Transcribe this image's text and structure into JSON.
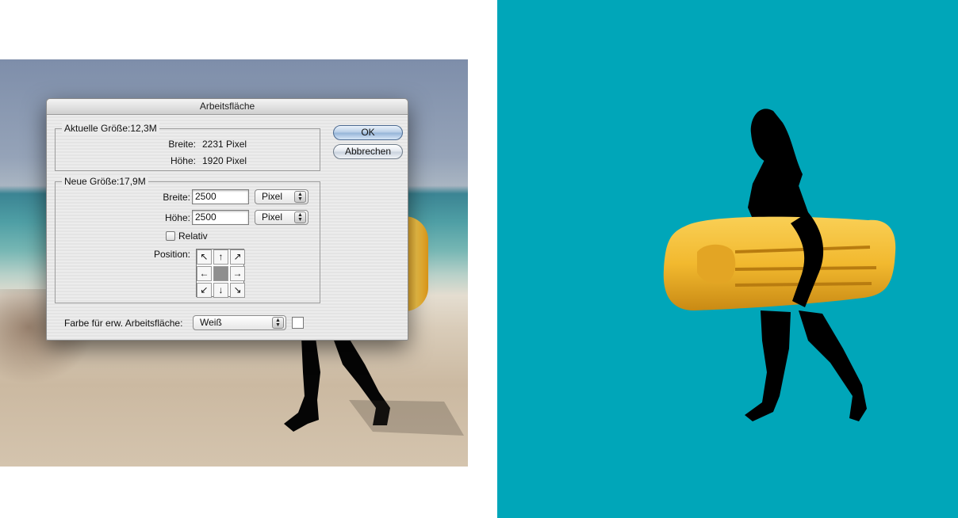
{
  "dialog": {
    "title": "Arbeitsfläche",
    "current": {
      "legend": "Aktuelle Größe:12,3M",
      "width_label": "Breite:",
      "width_value": "2231 Pixel",
      "height_label": "Höhe:",
      "height_value": "1920 Pixel"
    },
    "new_size": {
      "legend": "Neue Größe:17,9M",
      "width_label": "Breite:",
      "width_value": "2500",
      "width_unit": "Pixel",
      "height_label": "Höhe:",
      "height_value": "2500",
      "height_unit": "Pixel",
      "relative_label": "Relativ",
      "relative_checked": false,
      "position_label": "Position:",
      "anchor_arrows": [
        "↖",
        "↑",
        "↗",
        "←",
        "",
        "→",
        "↙",
        "↓",
        "↘"
      ]
    },
    "extension_color_label": "Farbe für erw. Arbeitsfläche:",
    "extension_color_value": "Weiß",
    "extension_color_swatch": "#ffffff",
    "ok_label": "OK",
    "cancel_label": "Abbrechen"
  },
  "colors": {
    "teal_background": "#00a6b9",
    "mattress": "#f2b92f",
    "silhouette": "#000000"
  }
}
